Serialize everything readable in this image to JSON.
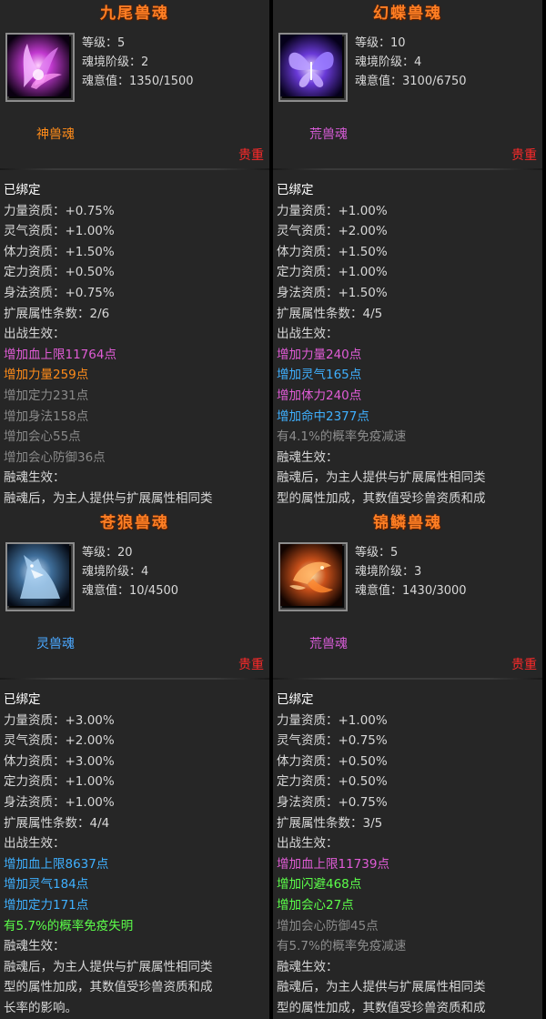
{
  "colors": {
    "title": "#ff7f24",
    "shen": "#ff8c1a",
    "huang": "#d65cd6",
    "ling": "#4aa8ff",
    "rarity": "#ff2a2a",
    "white": "#ffffff",
    "text": "#d8d8d8",
    "magenta": "#e05cd6",
    "orange": "#ff8c1a",
    "gray": "#8a8a8a",
    "blue": "#3fb0ff",
    "green": "#5cff4a",
    "darkgray": "#8e8e8e"
  },
  "cards": [
    {
      "title": "九尾兽魂",
      "icon": "nine-tail-fox-spirit",
      "stats": [
        "等级：5",
        "魂境阶级：2",
        "魂意值：1350/1500"
      ],
      "type": "神兽魂",
      "type_color": "#ff8c1a",
      "rarity": "贵重",
      "lines": [
        {
          "t": "已绑定",
          "c": "#ffffff"
        },
        {
          "t": "力量资质：+0.75%",
          "c": "#d8d8d8"
        },
        {
          "t": "灵气资质：+1.00%",
          "c": "#d8d8d8"
        },
        {
          "t": "体力资质：+1.50%",
          "c": "#d8d8d8"
        },
        {
          "t": "定力资质：+0.50%",
          "c": "#d8d8d8"
        },
        {
          "t": "身法资质：+0.75%",
          "c": "#d8d8d8"
        },
        {
          "t": "扩展属性条数：2/6",
          "c": "#d8d8d8"
        },
        {
          "t": "出战生效：",
          "c": "#d8d8d8"
        },
        {
          "t": "增加血上限11764点",
          "c": "#e05cd6"
        },
        {
          "t": "增加力量259点",
          "c": "#ff8c1a"
        },
        {
          "t": "增加定力231点",
          "c": "#8a8a8a"
        },
        {
          "t": "增加身法158点",
          "c": "#8a8a8a"
        },
        {
          "t": "增加会心55点",
          "c": "#8a8a8a"
        },
        {
          "t": "增加会心防御36点",
          "c": "#8a8a8a"
        },
        {
          "t": "融魂生效：",
          "c": "#d8d8d8"
        },
        {
          "t": "融魂后，为主人提供与扩展属性相同类",
          "c": "#d8d8d8"
        }
      ]
    },
    {
      "title": "幻蝶兽魂",
      "icon": "butterfly-spirit",
      "stats": [
        "等级：10",
        "魂境阶级：4",
        "魂意值：3100/6750"
      ],
      "type": "荒兽魂",
      "type_color": "#d65cd6",
      "rarity": "贵重",
      "lines": [
        {
          "t": "已绑定",
          "c": "#ffffff"
        },
        {
          "t": "力量资质：+1.00%",
          "c": "#d8d8d8"
        },
        {
          "t": "灵气资质：+2.00%",
          "c": "#d8d8d8"
        },
        {
          "t": "体力资质：+1.50%",
          "c": "#d8d8d8"
        },
        {
          "t": "定力资质：+1.00%",
          "c": "#d8d8d8"
        },
        {
          "t": "身法资质：+1.50%",
          "c": "#d8d8d8"
        },
        {
          "t": "扩展属性条数：4/5",
          "c": "#d8d8d8"
        },
        {
          "t": "出战生效：",
          "c": "#d8d8d8"
        },
        {
          "t": "增加力量240点",
          "c": "#e05cd6"
        },
        {
          "t": "增加灵气165点",
          "c": "#3fb0ff"
        },
        {
          "t": "增加体力240点",
          "c": "#e05cd6"
        },
        {
          "t": "增加命中2377点",
          "c": "#3fb0ff"
        },
        {
          "t": "有4.1%的概率免疫减速",
          "c": "#8e8e8e"
        },
        {
          "t": "融魂生效：",
          "c": "#d8d8d8"
        },
        {
          "t": "融魂后，为主人提供与扩展属性相同类",
          "c": "#d8d8d8"
        },
        {
          "t": "型的属性加成，其数值受珍兽资质和成",
          "c": "#d8d8d8"
        }
      ]
    },
    {
      "title": "苍狼兽魂",
      "icon": "wolf-spirit",
      "stats": [
        "等级：20",
        "魂境阶级：4",
        "魂意值：10/4500"
      ],
      "type": "灵兽魂",
      "type_color": "#4aa8ff",
      "rarity": "贵重",
      "lines": [
        {
          "t": "已绑定",
          "c": "#ffffff"
        },
        {
          "t": "力量资质：+3.00%",
          "c": "#d8d8d8"
        },
        {
          "t": "灵气资质：+2.00%",
          "c": "#d8d8d8"
        },
        {
          "t": "体力资质：+3.00%",
          "c": "#d8d8d8"
        },
        {
          "t": "定力资质：+1.00%",
          "c": "#d8d8d8"
        },
        {
          "t": "身法资质：+1.00%",
          "c": "#d8d8d8"
        },
        {
          "t": "扩展属性条数：4/4",
          "c": "#d8d8d8"
        },
        {
          "t": "出战生效：",
          "c": "#d8d8d8"
        },
        {
          "t": "增加血上限8637点",
          "c": "#3fb0ff"
        },
        {
          "t": "增加灵气184点",
          "c": "#3fb0ff"
        },
        {
          "t": "增加定力171点",
          "c": "#3fb0ff"
        },
        {
          "t": "有5.7%的概率免疫失明",
          "c": "#5cff4a"
        },
        {
          "t": "融魂生效：",
          "c": "#d8d8d8"
        },
        {
          "t": "融魂后，为主人提供与扩展属性相同类",
          "c": "#d8d8d8"
        },
        {
          "t": "型的属性加成，其数值受珍兽资质和成",
          "c": "#d8d8d8"
        },
        {
          "t": "长率的影响。",
          "c": "#d8d8d8"
        }
      ]
    },
    {
      "title": "锦鳞兽魂",
      "icon": "koi-fish-spirit",
      "stats": [
        "等级：5",
        "魂境阶级：3",
        "魂意值：1430/3000"
      ],
      "type": "荒兽魂",
      "type_color": "#d65cd6",
      "rarity": "贵重",
      "lines": [
        {
          "t": "已绑定",
          "c": "#ffffff"
        },
        {
          "t": "力量资质：+1.00%",
          "c": "#d8d8d8"
        },
        {
          "t": "灵气资质：+0.75%",
          "c": "#d8d8d8"
        },
        {
          "t": "体力资质：+0.50%",
          "c": "#d8d8d8"
        },
        {
          "t": "定力资质：+0.50%",
          "c": "#d8d8d8"
        },
        {
          "t": "身法资质：+0.75%",
          "c": "#d8d8d8"
        },
        {
          "t": "扩展属性条数：3/5",
          "c": "#d8d8d8"
        },
        {
          "t": "出战生效：",
          "c": "#d8d8d8"
        },
        {
          "t": "增加血上限11739点",
          "c": "#e05cd6"
        },
        {
          "t": "增加闪避468点",
          "c": "#5cff4a"
        },
        {
          "t": "增加会心27点",
          "c": "#5cff4a"
        },
        {
          "t": "增加会心防御45点",
          "c": "#8a8a8a"
        },
        {
          "t": "有5.7%的概率免疫减速",
          "c": "#8e8e8e"
        },
        {
          "t": "融魂生效：",
          "c": "#d8d8d8"
        },
        {
          "t": "融魂后，为主人提供与扩展属性相同类",
          "c": "#d8d8d8"
        },
        {
          "t": "型的属性加成，其数值受珍兽资质和成",
          "c": "#d8d8d8"
        }
      ]
    }
  ]
}
